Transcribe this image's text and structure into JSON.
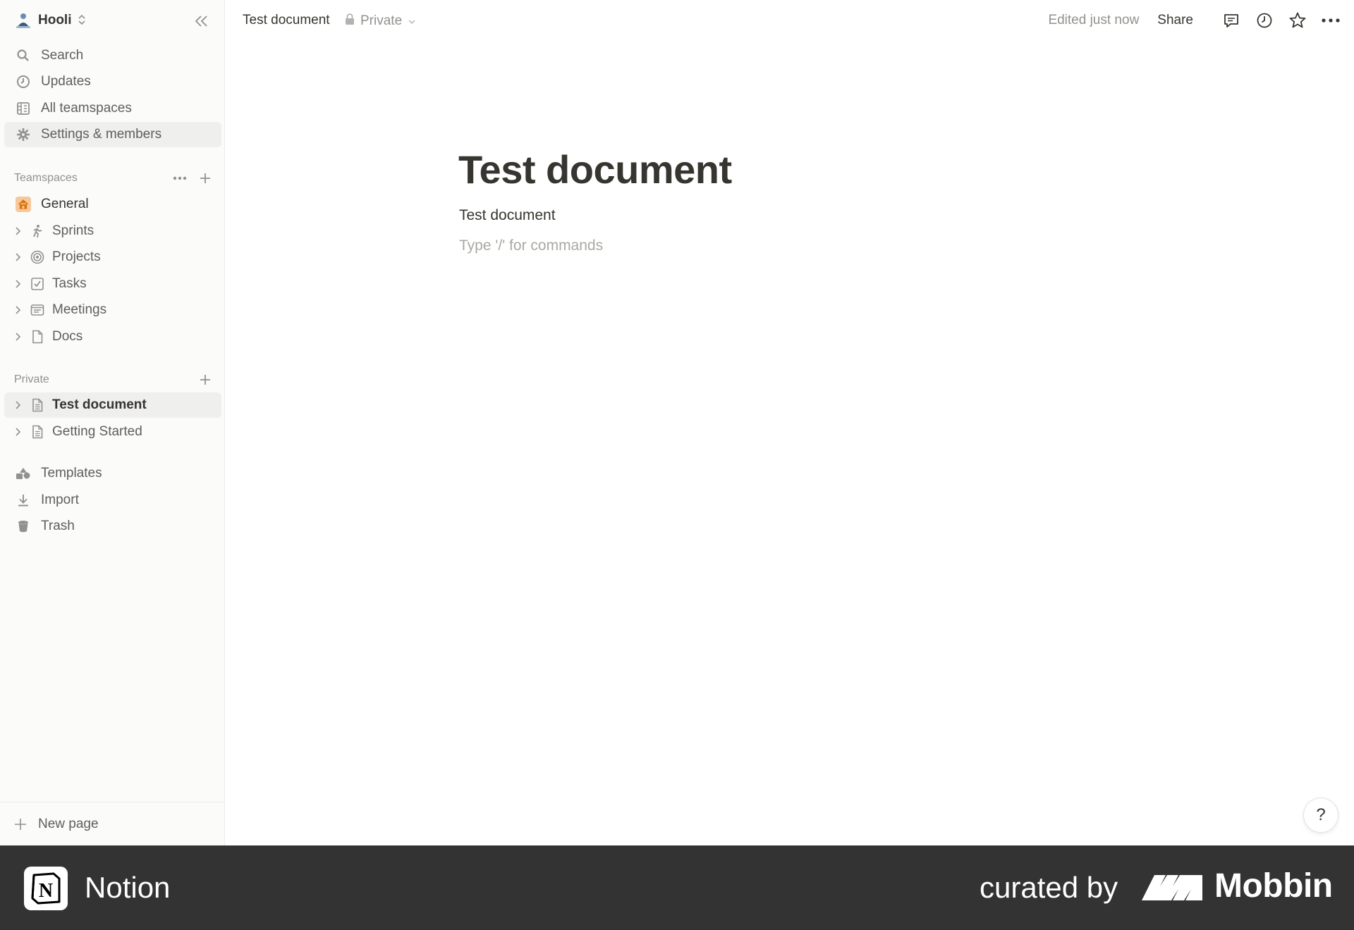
{
  "workspace": {
    "name": "Hooli"
  },
  "sidebar": {
    "nav": [
      {
        "label": "Search",
        "icon": "search-icon"
      },
      {
        "label": "Updates",
        "icon": "clock-icon"
      },
      {
        "label": "All teamspaces",
        "icon": "building-icon"
      },
      {
        "label": "Settings & members",
        "icon": "gear-icon",
        "active": true
      }
    ],
    "teamspaces_label": "Teamspaces",
    "teamspaces": [
      {
        "label": "General",
        "icon": "home-icon"
      },
      {
        "label": "Sprints",
        "icon": "runner-icon"
      },
      {
        "label": "Projects",
        "icon": "target-icon"
      },
      {
        "label": "Tasks",
        "icon": "checkbox-icon"
      },
      {
        "label": "Meetings",
        "icon": "notes-icon"
      },
      {
        "label": "Docs",
        "icon": "page-icon"
      }
    ],
    "private_label": "Private",
    "private_pages": [
      {
        "label": "Test document",
        "icon": "doc-icon",
        "active": true
      },
      {
        "label": "Getting Started",
        "icon": "doc-icon"
      }
    ],
    "utilities": [
      {
        "label": "Templates",
        "icon": "templates-icon"
      },
      {
        "label": "Import",
        "icon": "download-icon"
      },
      {
        "label": "Trash",
        "icon": "trash-icon"
      }
    ],
    "new_page_label": "New page"
  },
  "topbar": {
    "breadcrumb": "Test document",
    "privacy": "Private",
    "edited": "Edited just now",
    "share": "Share"
  },
  "page": {
    "title": "Test document",
    "body": "Test document",
    "placeholder": "Type '/' for commands"
  },
  "help": {
    "label": "?"
  },
  "banner": {
    "app_name": "Notion",
    "curated_by": "curated by",
    "brand": "Mobbin"
  },
  "colors": {
    "sidebar_bg": "#fbfbfa",
    "text": "#37352f",
    "muted": "#91918e",
    "active_bg": "#efefed",
    "general_icon_bg": "#f5c99b",
    "banner_bg": "#333333"
  }
}
